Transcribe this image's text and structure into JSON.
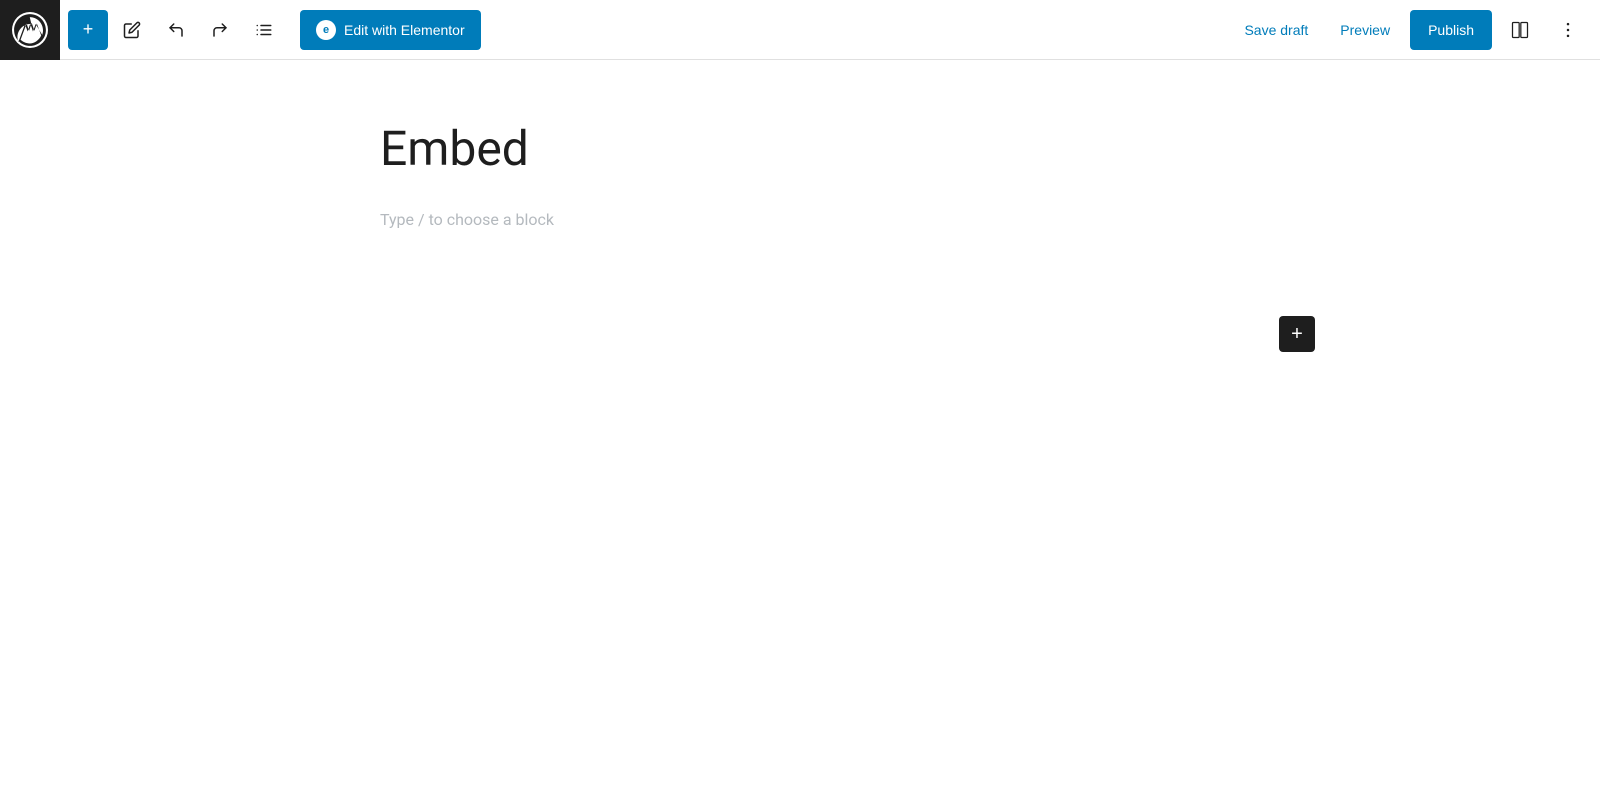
{
  "toolbar": {
    "add_label": "+",
    "pencil_icon": "pencil-icon",
    "undo_icon": "undo-icon",
    "redo_icon": "redo-icon",
    "list_icon": "list-icon",
    "edit_elementor_label": "Edit with Elementor",
    "save_draft_label": "Save draft",
    "preview_label": "Preview",
    "publish_label": "Publish",
    "view_toggle_icon": "view-toggle-icon",
    "more_icon": "more-options-icon"
  },
  "editor": {
    "post_title": "Embed",
    "block_placeholder": "Type / to choose a block"
  },
  "colors": {
    "primary": "#007cba",
    "dark": "#1e1e1e",
    "text_muted": "#b4b9be"
  }
}
